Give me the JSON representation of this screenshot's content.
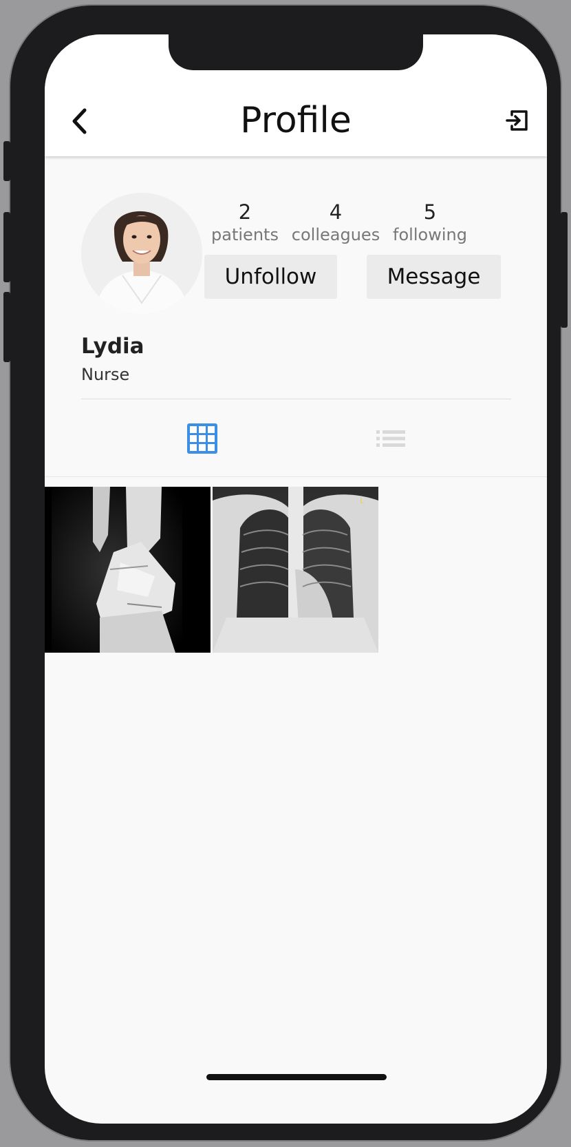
{
  "header": {
    "title": "Profile"
  },
  "profile": {
    "name": "Lydia",
    "role": "Nurse",
    "stats": [
      {
        "value": "2",
        "label": "patients"
      },
      {
        "value": "4",
        "label": "colleagues"
      },
      {
        "value": "5",
        "label": "following"
      }
    ],
    "buttons": {
      "unfollow": "Unfollow",
      "message": "Message"
    }
  },
  "tabs": [
    {
      "icon": "grid-icon",
      "active": true,
      "color": "#3d8fe6"
    },
    {
      "icon": "list-icon",
      "active": false,
      "color": "#d9d9d9"
    }
  ],
  "posts": [
    {
      "kind": "leg-fracture-xray"
    },
    {
      "kind": "chest-xray",
      "overlay_letter": "L",
      "overlay_color": "#e8d44d"
    }
  ]
}
